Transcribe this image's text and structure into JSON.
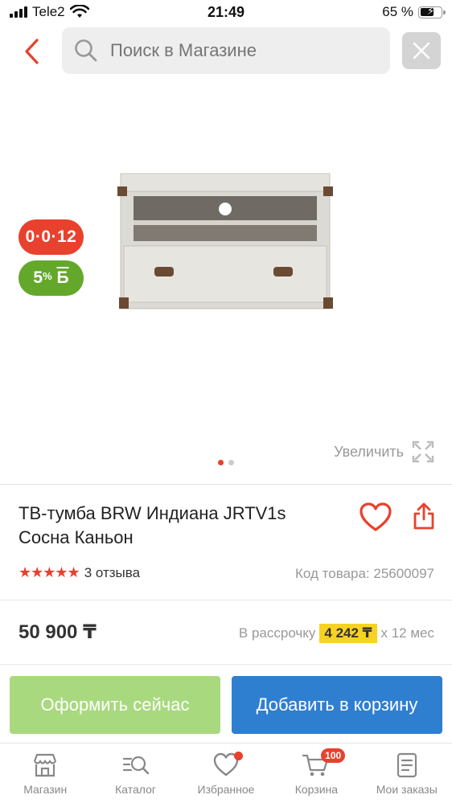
{
  "status_bar": {
    "carrier": "Tele2",
    "time": "21:49",
    "battery": "65 %",
    "battery_level": 0.65
  },
  "search": {
    "placeholder": "Поиск в Магазине"
  },
  "gallery": {
    "badge_installment": "0·0·12",
    "badge_bonus_value": "5",
    "badge_bonus_suffix": "Б",
    "zoom_label": "Увеличить",
    "dots_total": 2,
    "dots_active": 1
  },
  "product": {
    "title": "ТВ-тумба BRW Индиана JRTV1s Сосна Каньон",
    "rating_stars": 5,
    "reviews": "3 отзыва",
    "code": "Код товара: 25600097",
    "price": "50 900 ₸",
    "installment_prefix": "В рассрочку",
    "installment_amount": "4 242 ₸",
    "installment_suffix": "х 12 мес"
  },
  "actions": {
    "buy_now": "Оформить сейчас",
    "add_to_cart": "Добавить в корзину"
  },
  "tabbar": {
    "items": [
      {
        "label": "Магазин",
        "icon": "store-icon"
      },
      {
        "label": "Каталог",
        "icon": "catalog-search-icon"
      },
      {
        "label": "Избранное",
        "icon": "heart-icon"
      },
      {
        "label": "Корзина",
        "icon": "cart-icon"
      },
      {
        "label": "Мои заказы",
        "icon": "orders-icon"
      }
    ],
    "cart_count": "100"
  },
  "colors": {
    "accent": "#e8412d",
    "green": "#63a82b",
    "buy_button": "#a9d97f",
    "cart_button": "#2f7fd0",
    "highlight": "#f7d321"
  }
}
